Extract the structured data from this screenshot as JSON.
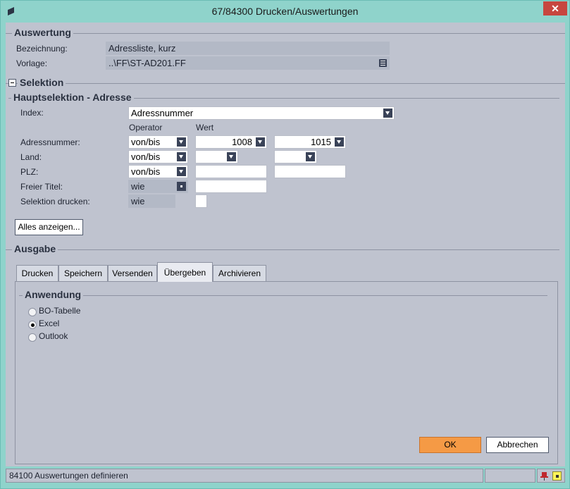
{
  "window": {
    "title": "67/84300 Drucken/Auswertungen",
    "close_glyph": "✕"
  },
  "auswertung": {
    "header": "Auswertung",
    "bezeichnung_label": "Bezeichnung:",
    "bezeichnung_value": "Adressliste, kurz",
    "vorlage_label": "Vorlage:",
    "vorlage_value": "..\\FF\\ST-AD201.FF"
  },
  "selektion": {
    "header": "Selektion",
    "hauptselektion_header": "Hauptselektion - Adresse",
    "index_label": "Index:",
    "index_value": "Adressnummer",
    "operator_header": "Operator",
    "wert_header": "Wert",
    "rows": [
      {
        "label": "Adressnummer:",
        "operator": "von/bis",
        "from": "1008",
        "to": "1015"
      },
      {
        "label": "Land:",
        "operator": "von/bis",
        "from": "",
        "to": ""
      },
      {
        "label": "PLZ:",
        "operator": "von/bis",
        "from": "",
        "to": ""
      },
      {
        "label": "Freier Titel:",
        "operator": "wie",
        "from": ""
      },
      {
        "label": "Selektion drucken:",
        "operator": "wie"
      }
    ],
    "show_all_button": "Alles anzeigen..."
  },
  "ausgabe": {
    "header": "Ausgabe",
    "tabs": [
      "Drucken",
      "Speichern",
      "Versenden",
      "Übergeben",
      "Archivieren"
    ],
    "active_tab": "Übergeben",
    "anwendung_header": "Anwendung",
    "options": [
      "BO-Tabelle",
      "Excel",
      "Outlook"
    ],
    "selected_option": "Excel"
  },
  "buttons": {
    "ok": "OK",
    "cancel": "Abbrechen"
  },
  "status": {
    "text": "84100 Auswertungen definieren"
  },
  "colors": {
    "accent": "#f59a45",
    "window_frame": "#8fd3cb",
    "panel": "#bfc3cf",
    "close": "#c7463f"
  }
}
